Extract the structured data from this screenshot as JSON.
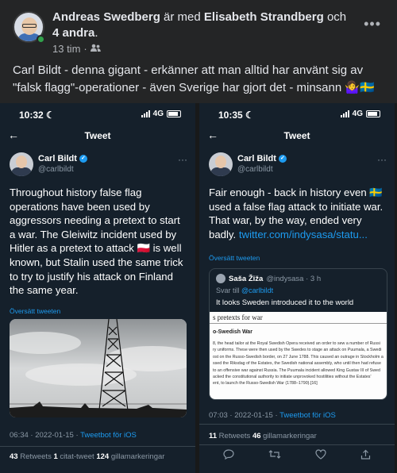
{
  "post": {
    "author": "Andreas Swedberg",
    "with_text": " är med ",
    "tagged": "Elisabeth Strandberg",
    "and_text": " och ",
    "others": "4 andra",
    "period": ".",
    "time": "13 tim",
    "dot": "·",
    "text": "Carl Bildt - denna gigant - erkänner att man alltid har använt sig av \"falsk flagg\"-operationer - även Sverige har gjort det - minsann 🤷‍♀️🇸🇪"
  },
  "shot1": {
    "time": "10:32",
    "network": "4G",
    "header": "Tweet",
    "name": "Carl Bildt",
    "handle": "@carlbildt",
    "text": "Throughout history false flag operations have been used by aggressors needing a pretext to start a war. The Gleiwitz incident used by Hitler as a pretext to attack 🇵🇱 is well known, but Stalin used the same trick to try to justify his attack on Finland the same year.",
    "translate": "Översätt tweeten",
    "timestamp": "06:34 · 2022-01-15 · ",
    "source": "Tweetbot för iOS",
    "retweets": "43",
    "retweets_label": " Retweets  ",
    "quotes": "1",
    "quotes_label": " citat-tweet  ",
    "likes": "124",
    "likes_label": " gillamarkeringar"
  },
  "shot2": {
    "time": "10:35",
    "network": "4G",
    "header": "Tweet",
    "name": "Carl Bildt",
    "handle": "@carlbildt",
    "text": "Fair enough - back in history even 🇸🇪 used a false flag attack to initiate war. That war, by the way, ended very badly.",
    "link": "twitter.com/indysasa/statu...",
    "translate": "Översätt tweeten",
    "quote": {
      "name": "Saša Žiža",
      "handle": "@indysasa · 3 h",
      "reply_prefix": "Svar till ",
      "reply_to": "@carlbildt",
      "text": "It looks Sweden introduced it to the world",
      "img_title": "s pretexts for war",
      "img_heading": "o-Swedish War",
      "img_lines": [
        "8, the head tailor at the Royal Swedish Opera received an order to sew a number of Russi",
        "ry uniforms. These were then used by the Swedes to stage an attack on Puumala, a Swedi",
        "ost on the Russo-Swedish border, on 27 June 1788. This caused an outrage in Stockholm a",
        "ssed the Riksdag of the Estates, the Swedish national assembly, who until then had refuse",
        "to an offensive war against Russia. The Puumala incident allowed King Gustav III of Swed",
        "acked the constitutional authority to initiate unprovoked hostilities without the Estates'",
        "ent, to launch the Russo-Swedish War (1788–1790).[16]"
      ]
    },
    "timestamp": "07:03 · 2022-01-15 · ",
    "source": "Tweetbot för iOS",
    "retweets": "11",
    "retweets_label": " Retweets  ",
    "likes": "46",
    "likes_label": " gillamarkeringar"
  }
}
